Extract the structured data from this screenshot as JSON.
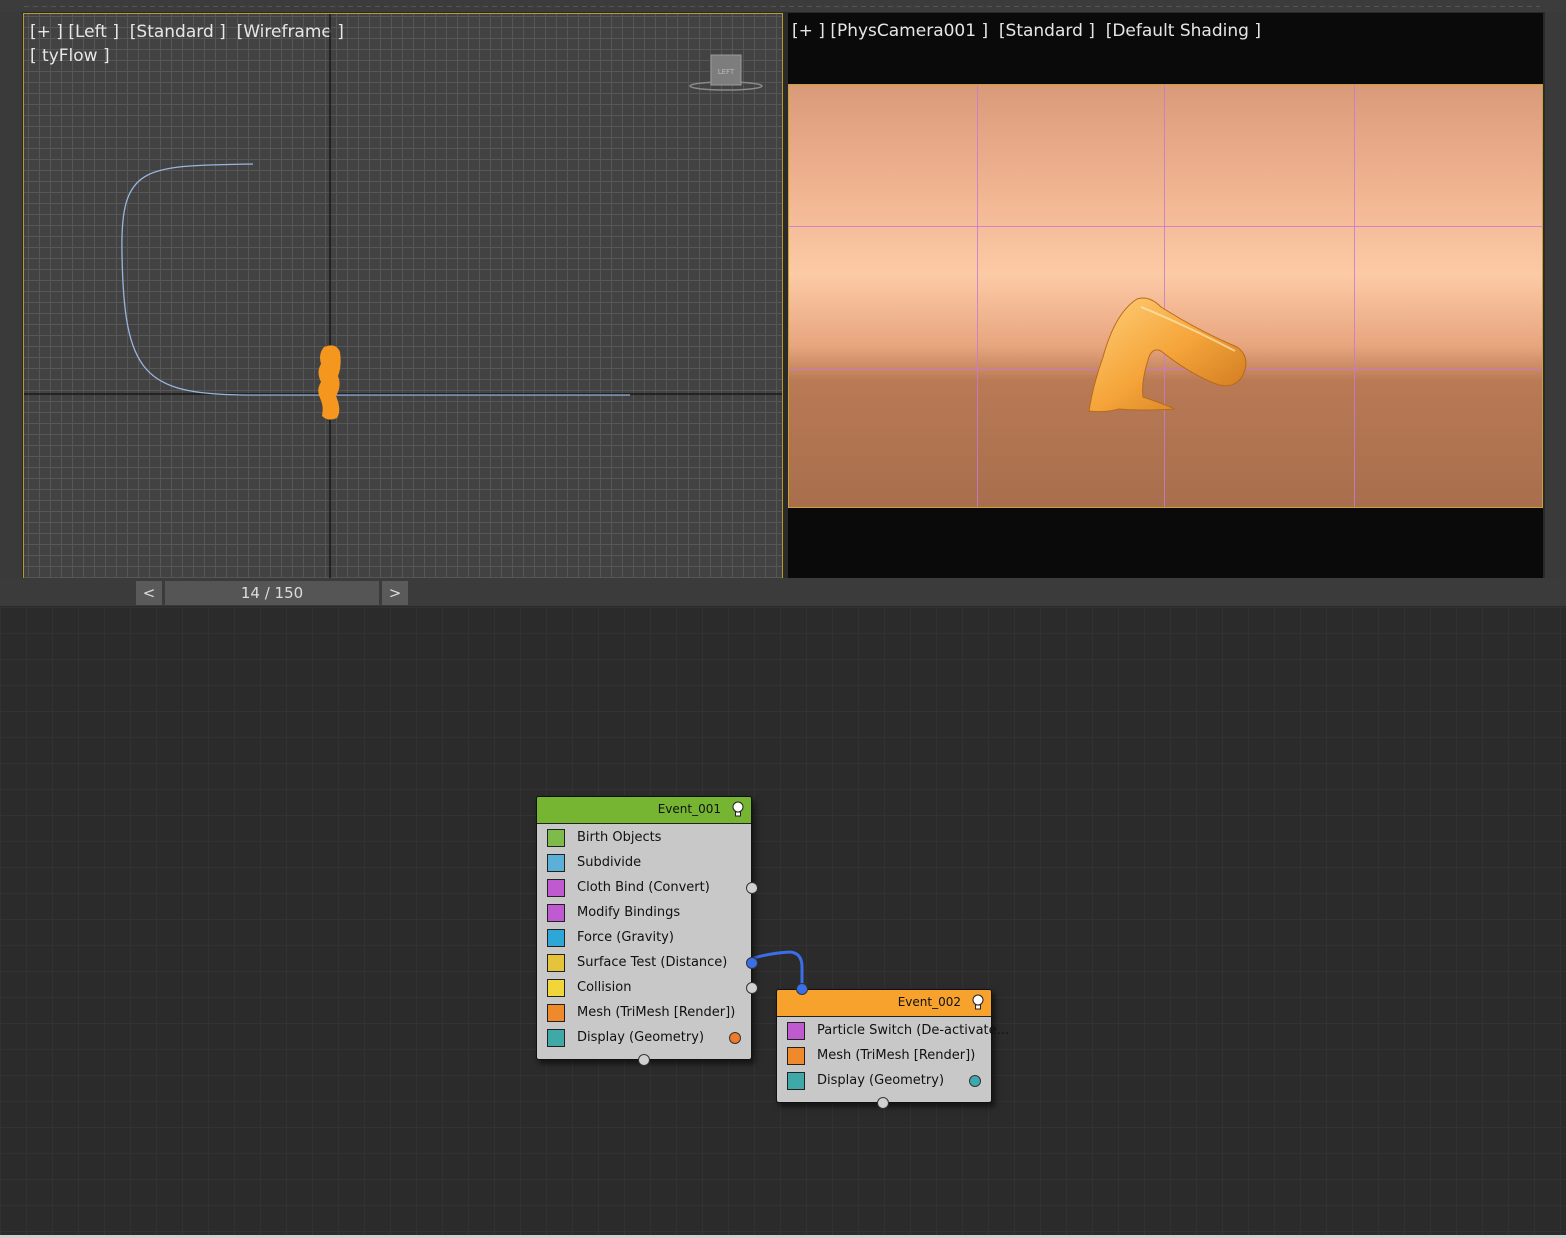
{
  "viewport_left": {
    "label_line1": "[+ ] [Left ]  [Standard ]  [Wireframe ]",
    "label_line2": "[ tyFlow ]",
    "viewcube_label": "LEFT"
  },
  "viewport_right": {
    "label_line1": "[+ ] [PhysCamera001 ]  [Standard ]  [Default Shading ]"
  },
  "timeline": {
    "prev_label": "<",
    "frame_display": "14 / 150",
    "next_label": ">"
  },
  "event_001": {
    "title": "Event_001",
    "header_color": "#76b532",
    "operators": [
      {
        "label": "Birth Objects",
        "icon": "birth-objects-icon",
        "color": "#7dbb4a"
      },
      {
        "label": "Subdivide",
        "icon": "subdivide-icon",
        "color": "#5bb0d8"
      },
      {
        "label": "Cloth Bind (Convert)",
        "icon": "cloth-bind-icon",
        "color": "#c05ad0"
      },
      {
        "label": "Modify Bindings",
        "icon": "modify-bindings-icon",
        "color": "#c05ad0"
      },
      {
        "label": "Force (Gravity)",
        "icon": "force-icon",
        "color": "#2ea7d6"
      },
      {
        "label": "Surface Test (Distance)",
        "icon": "surface-test-icon",
        "color": "#e5c33a"
      },
      {
        "label": "Collision",
        "icon": "collision-icon",
        "color": "#f0d63a"
      },
      {
        "label": "Mesh (TriMesh [Render])",
        "icon": "mesh-icon",
        "color": "#ef8a2c"
      },
      {
        "label": "Display (Geometry)",
        "icon": "display-icon",
        "color": "#3ea9a8"
      }
    ],
    "display_swatch": "#f07a2a"
  },
  "event_002": {
    "title": "Event_002",
    "header_color": "#f6a22c",
    "operators": [
      {
        "label": "Particle Switch (De-activate...",
        "icon": "particle-switch-icon",
        "color": "#c05ad0"
      },
      {
        "label": "Mesh (TriMesh [Render])",
        "icon": "mesh-icon",
        "color": "#ef8a2c"
      },
      {
        "label": "Display (Geometry)",
        "icon": "display-icon",
        "color": "#3ea9a8"
      }
    ],
    "display_swatch": "#3fa9b0"
  },
  "colors": {
    "particle_orange": "#f5961e",
    "link_blue": "#3a6fe8",
    "viewport_border": "#b99a30"
  }
}
